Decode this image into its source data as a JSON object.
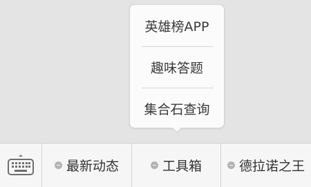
{
  "popup": {
    "items": [
      {
        "label": "英雄榜APP"
      },
      {
        "label": "趣味答题"
      },
      {
        "label": "集合石查询"
      }
    ]
  },
  "bottom_bar": {
    "keyboard_icon": "keyboard-icon",
    "menus": [
      {
        "label": "最新动态",
        "icon": "menu-dot-icon"
      },
      {
        "label": "工具箱",
        "icon": "menu-dot-icon"
      },
      {
        "label": "德拉诺之王",
        "icon": "menu-dot-icon"
      }
    ]
  },
  "colors": {
    "background": "#e4e4e4",
    "bar_background": "#f6f6f6",
    "popup_background": "#fbfbfb",
    "divider": "#d2d2d2",
    "text": "#333333",
    "dot": "#b3b3b3"
  }
}
